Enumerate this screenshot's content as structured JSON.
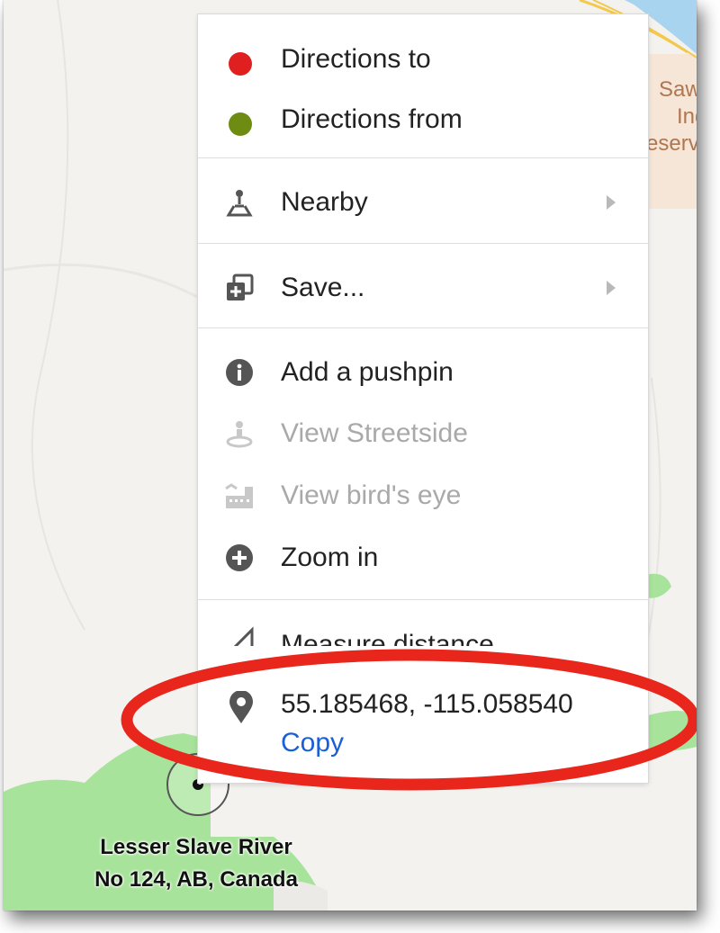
{
  "map": {
    "place_label_lines": [
      "Saw",
      "Ind",
      "eserv"
    ],
    "region_label_line1": "Lesser Slave River",
    "region_label_line2": "No 124, AB, Canada"
  },
  "context_menu": {
    "directions": [
      {
        "label": "Directions to",
        "dot_color": "#e02020"
      },
      {
        "label": "Directions from",
        "dot_color": "#6f8c12"
      }
    ],
    "nearby_label": "Nearby",
    "save_label": "Save...",
    "actions": [
      {
        "label": "Add a pushpin",
        "enabled": true
      },
      {
        "label": "View Streetside",
        "enabled": false
      },
      {
        "label": "View bird's eye",
        "enabled": false
      },
      {
        "label": "Zoom in",
        "enabled": true
      }
    ],
    "measure_label": "Measure distance",
    "coordinates": "55.185468, -115.058540",
    "copy_label": "Copy"
  },
  "colors": {
    "annotation_ellipse": "#e8261c",
    "link": "#1a5fd6",
    "map_green": "#a8e39b"
  }
}
